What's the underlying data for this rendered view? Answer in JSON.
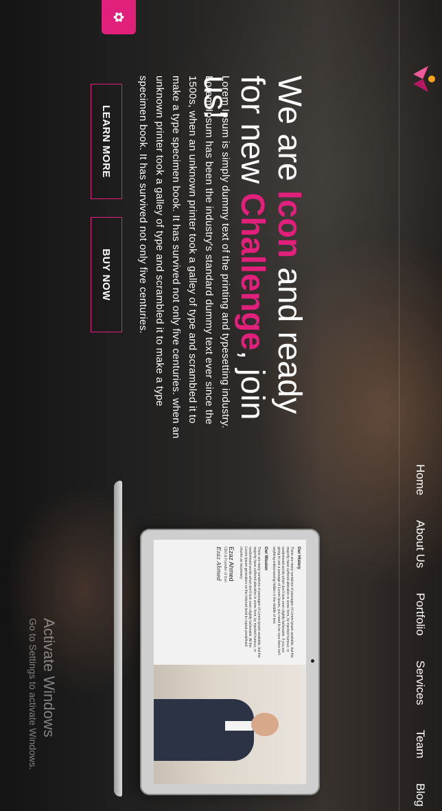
{
  "nav": {
    "items": [
      "Home",
      "About Us",
      "Portfolio",
      "Services",
      "Team",
      "Blog"
    ]
  },
  "hero": {
    "title_pre": "We are ",
    "title_accent1": "Icon",
    "title_mid": " and ready for new ",
    "title_accent2": "Challenge",
    "title_post": ", join us!",
    "paragraph": "Lorem Ipsum is simply dummy text of the printing and typesetting industry. Lorem Ipsum has been the industry's standard dummy text ever since the 1500s, when an unknown printer took a galley of type and scrambled it to make a type specimen book. It has survived not only five centuries. when an unknown printer took a galley of type and scrambled it to make a type specimen book. It has survived not only five centuries.",
    "learn_more_label": "LEARN MORE",
    "buy_now_label": "BUY NOW"
  },
  "laptop_screen": {
    "history_heading": "Our History",
    "history_text": "There are many variations of passages of Lorem Ipsum available, but the majority have suffered alteration in some form, by injected humour, or randomised words which don't look even slightly believable. If you are going to use a passage of Lorem Ipsum, you need to be sure there isn't anything embarrassing hidden in the middle of text.",
    "mission_heading": "Our Mission",
    "mission_text": "There are many variations of passages of Lorem Ipsum available, but the majority have suffered alteration in some form, by injected humour, or randomised words which don't look even slightly believable. All the Lorem Ipsum generators on the Internet tend to repeat predefined chunks as necessary.",
    "person_name": "Ezaz Ahmed",
    "person_role": "CEO & Founder of Icon",
    "signature": "Ezaz Ahmed"
  },
  "watermark": {
    "line1": "Activate Windows",
    "line2": "Go to Settings to activate Windows."
  },
  "colors": {
    "accent": "#e0207a"
  },
  "icons": {
    "settings": "gear-icon",
    "logo": "brand-logo"
  }
}
